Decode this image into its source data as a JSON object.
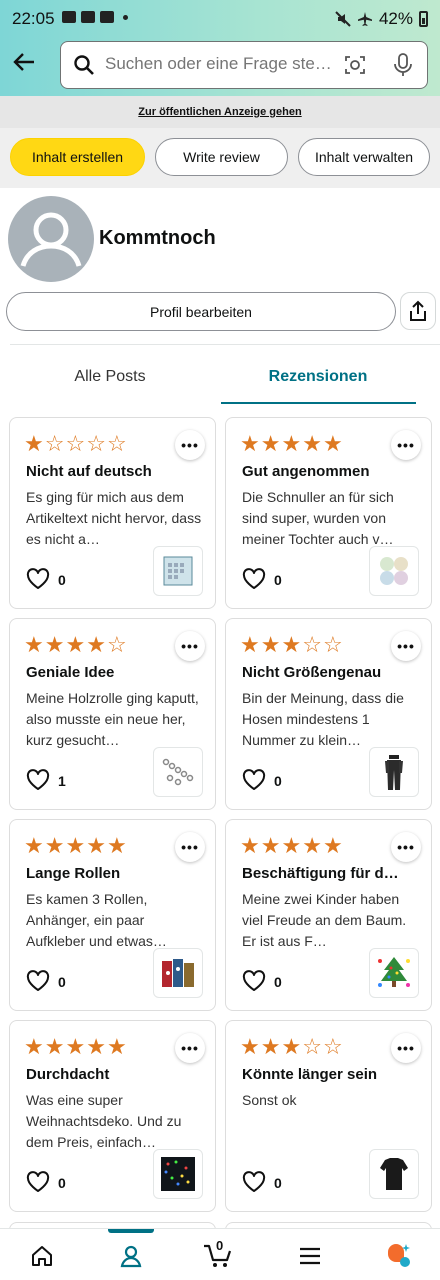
{
  "status_bar": {
    "time": "22:05",
    "battery": "42%"
  },
  "search": {
    "placeholder": "Suchen oder eine Frage ste…"
  },
  "public_view_link": "Zur öffentlichen Anzeige gehen",
  "actions": {
    "create_content": "Inhalt erstellen",
    "write_review": "Write review",
    "manage_content": "Inhalt verwalten"
  },
  "profile": {
    "name": "Kommtnoch",
    "edit_label": "Profil bearbeiten"
  },
  "tabs": {
    "all_posts": "Alle Posts",
    "reviews": "Rezensionen",
    "selected": "reviews"
  },
  "reviews": [
    {
      "rating": 1,
      "title": "Nicht auf deutsch",
      "text": "Es ging für mich aus dem Artikeltext nicht hervor, dass es nicht a…",
      "likes": "0",
      "thumb_icon": "calendar-product-icon"
    },
    {
      "rating": 5,
      "title": "Gut angenommen",
      "text": "Die Schnuller an für sich sind super, wurden von meiner Tochter auch v…",
      "likes": "0",
      "thumb_icon": "pacifier-product-icon"
    },
    {
      "rating": 4,
      "title": "Geniale Idee",
      "text": "Meine Holzrolle ging kaputt, also musste ein neue her, kurz gesucht…",
      "likes": "1",
      "thumb_icon": "roller-product-icon"
    },
    {
      "rating": 3,
      "title": "Nicht Größengenau",
      "text": "Bin der Meinung, dass die Hosen mindestens 1 Nummer zu klein…",
      "likes": "0",
      "thumb_icon": "pants-product-icon"
    },
    {
      "rating": 5,
      "title": "Lange Rollen",
      "text": "Es kamen 3 Rollen, Anhänger, ein paar Aufkleber und etwas…",
      "likes": "0",
      "thumb_icon": "gift-wrap-product-icon"
    },
    {
      "rating": 5,
      "title": "Beschäftigung für d…",
      "text": "Meine zwei Kinder haben viel Freude an dem Baum. Er ist aus F…",
      "likes": "0",
      "thumb_icon": "felt-tree-product-icon"
    },
    {
      "rating": 5,
      "title": "Durchdacht",
      "text": "Was eine super Weihnachtsdeko. Und zu dem Preis, einfach…",
      "likes": "0",
      "thumb_icon": "lights-product-icon"
    },
    {
      "rating": 3,
      "title": "Könnte länger sein",
      "text": "Sonst ok",
      "likes": "0",
      "thumb_icon": "sweater-product-icon"
    }
  ],
  "bottom_nav": {
    "cart_count": "0",
    "active": "profile"
  },
  "colors": {
    "star": "#de7921",
    "accent": "#007185",
    "primary_button": "#ffd814",
    "header_start": "#7ed6d6",
    "header_end": "#bfe9cf"
  }
}
